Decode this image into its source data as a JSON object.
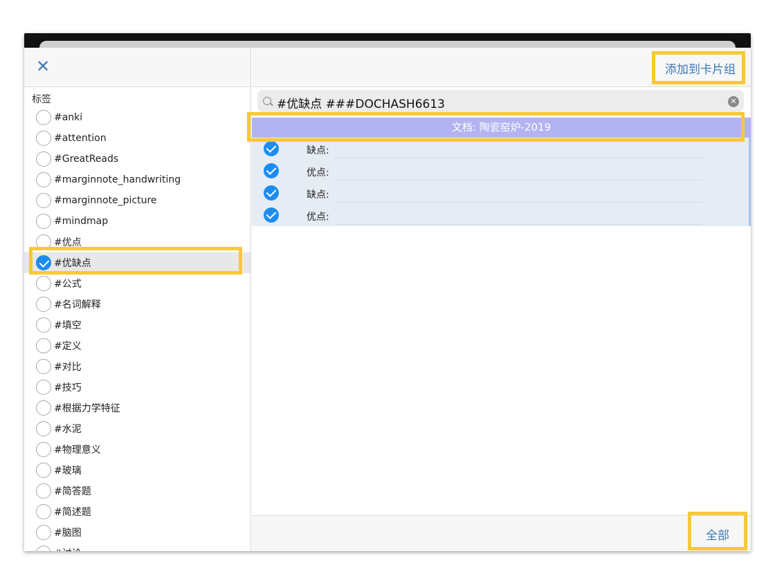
{
  "left_panel": {
    "section_title": "标签",
    "tags": [
      {
        "label": "#anki",
        "checked": false
      },
      {
        "label": "#attention",
        "checked": false
      },
      {
        "label": "#GreatReads",
        "checked": false
      },
      {
        "label": "#marginnote_handwriting",
        "checked": false
      },
      {
        "label": "#marginnote_picture",
        "checked": false
      },
      {
        "label": "#mindmap",
        "checked": false
      },
      {
        "label": "#优点",
        "checked": false
      },
      {
        "label": "#优缺点",
        "checked": true
      },
      {
        "label": "#公式",
        "checked": false
      },
      {
        "label": "#名词解释",
        "checked": false
      },
      {
        "label": "#填空",
        "checked": false
      },
      {
        "label": "#定义",
        "checked": false
      },
      {
        "label": "#对比",
        "checked": false
      },
      {
        "label": "#技巧",
        "checked": false
      },
      {
        "label": "#根据力学特征",
        "checked": false
      },
      {
        "label": "#水泥",
        "checked": false
      },
      {
        "label": "#物理意义",
        "checked": false
      },
      {
        "label": "#玻璃",
        "checked": false
      },
      {
        "label": "#简答题",
        "checked": false
      },
      {
        "label": "#简述题",
        "checked": false
      },
      {
        "label": "#脑图",
        "checked": false
      },
      {
        "label": "#讨论",
        "checked": false
      }
    ]
  },
  "right_panel": {
    "add_button": "添加到卡片组",
    "search_value": "#优缺点 ###DOCHASH6613",
    "document_title": "文档: 陶瓷窑炉-2019",
    "cards": [
      {
        "label": "缺点:",
        "checked": true
      },
      {
        "label": "优点:",
        "checked": true
      },
      {
        "label": "缺点:",
        "checked": true
      },
      {
        "label": "优点:",
        "checked": true
      }
    ],
    "all_button": "全部"
  },
  "colors": {
    "accent": "#3a78b8",
    "check": "#1d8cf0",
    "doc_bar": "#b3b3f2",
    "highlight": "#f7c934"
  }
}
